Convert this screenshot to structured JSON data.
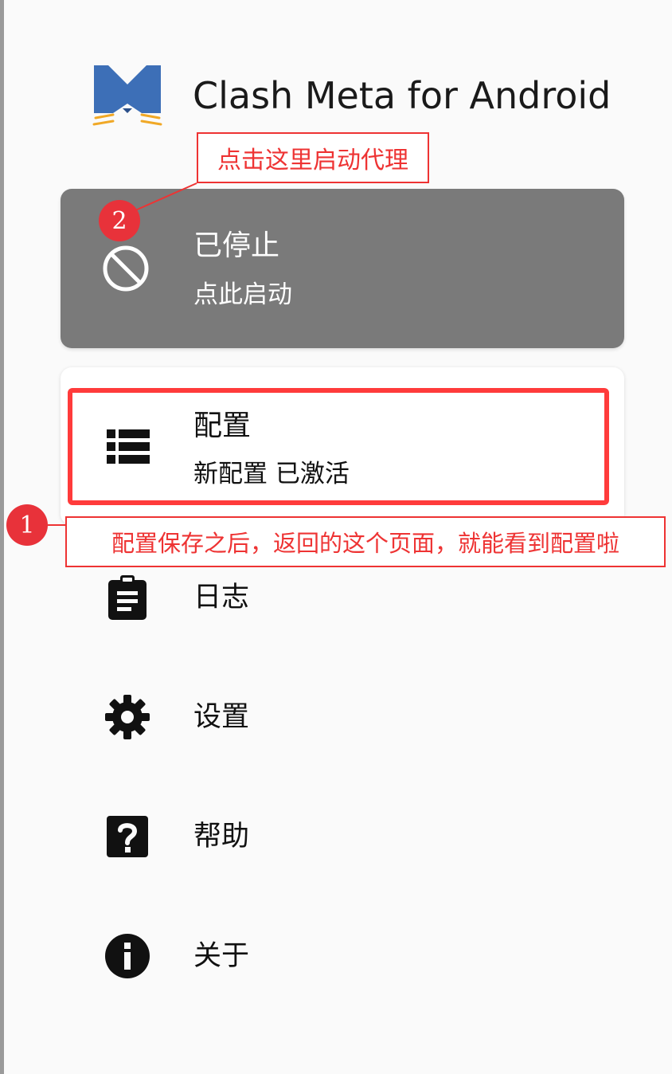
{
  "app": {
    "title": "Clash Meta for Android"
  },
  "annotations": {
    "top_callout": "点击这里启动代理",
    "top_badge": "2",
    "bottom_callout": "配置保存之后，返回的这个页面，就能看到配置啦",
    "bottom_badge": "1",
    "color": "#e33333"
  },
  "status_card": {
    "title": "已停止",
    "subtitle": "点此启动",
    "icon": "block-icon",
    "background": "#7a7a7a"
  },
  "profile_card": {
    "title": "配置",
    "subtitle": "新配置 已激活",
    "icon": "list-icon"
  },
  "menu": [
    {
      "label": "日志",
      "icon": "clipboard-icon"
    },
    {
      "label": "设置",
      "icon": "gear-icon"
    },
    {
      "label": "帮助",
      "icon": "help-icon"
    },
    {
      "label": "关于",
      "icon": "info-icon"
    }
  ]
}
